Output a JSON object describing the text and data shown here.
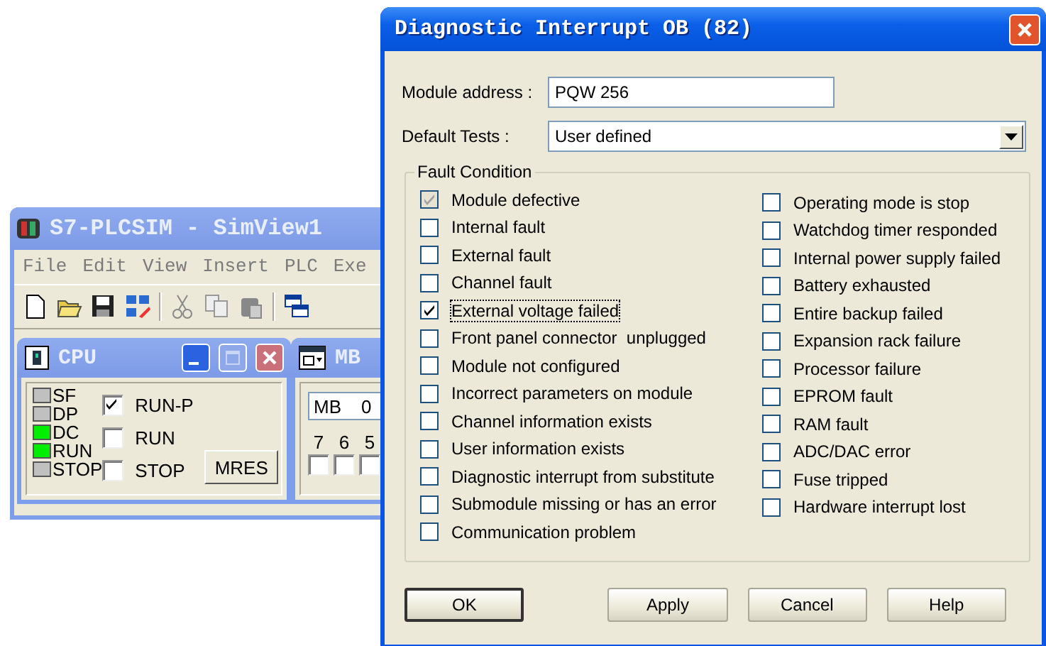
{
  "simulator_window": {
    "title": "S7-PLCSIM - SimView1",
    "menu": [
      "File",
      "Edit",
      "View",
      "Insert",
      "PLC",
      "Exe"
    ],
    "cpu_panel": {
      "title": "CPU",
      "leds": [
        {
          "label": "SF",
          "on": false
        },
        {
          "label": "DP",
          "on": false
        },
        {
          "label": "DC",
          "on": true
        },
        {
          "label": "RUN",
          "on": true
        },
        {
          "label": "STOP",
          "on": false
        }
      ],
      "modes": [
        {
          "label": "RUN-P",
          "checked": true
        },
        {
          "label": "RUN",
          "checked": false
        },
        {
          "label": "STOP",
          "checked": false
        }
      ],
      "mres_button": "MRES"
    },
    "mb_panel": {
      "title": "MB",
      "address_type": "MB",
      "address": "0",
      "bits": [
        {
          "label": "7",
          "checked": false
        },
        {
          "label": "6",
          "checked": false
        },
        {
          "label": "5",
          "checked": false
        }
      ]
    }
  },
  "dialog": {
    "title": "Diagnostic Interrupt OB (82)",
    "module_address": {
      "label": "Module address :",
      "value": "PQW 256"
    },
    "default_tests": {
      "label": "Default Tests :",
      "value": "User defined"
    },
    "fault_condition": {
      "title": "Fault Condition",
      "left": [
        {
          "label": "Module defective",
          "checked": true,
          "disabled": true,
          "focused": false
        },
        {
          "label": "Internal fault",
          "checked": false,
          "disabled": false,
          "focused": false
        },
        {
          "label": "External fault",
          "checked": false,
          "disabled": false,
          "focused": false
        },
        {
          "label": "Channel fault",
          "checked": false,
          "disabled": false,
          "focused": false
        },
        {
          "label": "External voltage failed",
          "checked": true,
          "disabled": false,
          "focused": true
        },
        {
          "label": "Front panel connector  unplugged",
          "checked": false,
          "disabled": false,
          "focused": false
        },
        {
          "label": "Module not configured",
          "checked": false,
          "disabled": false,
          "focused": false
        },
        {
          "label": "Incorrect parameters on module",
          "checked": false,
          "disabled": false,
          "focused": false
        },
        {
          "label": "Channel information exists",
          "checked": false,
          "disabled": false,
          "focused": false
        },
        {
          "label": "User information exists",
          "checked": false,
          "disabled": false,
          "focused": false
        },
        {
          "label": "Diagnostic interrupt from substitute",
          "checked": false,
          "disabled": false,
          "focused": false
        },
        {
          "label": "Submodule missing or has an error",
          "checked": false,
          "disabled": false,
          "focused": false
        },
        {
          "label": "Communication problem",
          "checked": false,
          "disabled": false,
          "focused": false
        }
      ],
      "right": [
        {
          "label": "Operating mode is stop",
          "checked": false
        },
        {
          "label": "Watchdog timer responded",
          "checked": false
        },
        {
          "label": "Internal power supply failed",
          "checked": false
        },
        {
          "label": "Battery exhausted",
          "checked": false
        },
        {
          "label": "Entire backup failed",
          "checked": false
        },
        {
          "label": "Expansion rack failure",
          "checked": false
        },
        {
          "label": "Processor failure",
          "checked": false
        },
        {
          "label": "EPROM fault",
          "checked": false
        },
        {
          "label": "RAM fault",
          "checked": false
        },
        {
          "label": "ADC/DAC error",
          "checked": false
        },
        {
          "label": "Fuse tripped",
          "checked": false
        },
        {
          "label": "Hardware interrupt lost",
          "checked": false
        }
      ]
    },
    "buttons": [
      {
        "label": "OK",
        "default": true
      },
      {
        "label": "Apply",
        "default": false
      },
      {
        "label": "Cancel",
        "default": false
      },
      {
        "label": "Help",
        "default": false
      }
    ]
  }
}
